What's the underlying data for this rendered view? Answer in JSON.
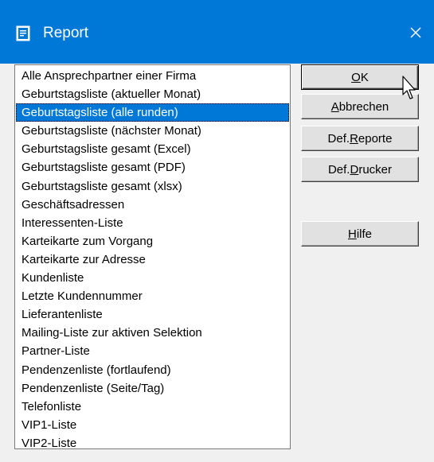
{
  "window": {
    "title": "Report",
    "app_icon": "report-document-icon",
    "close_icon": "close-icon",
    "colors": {
      "titlebar": "#0078d7",
      "selection": "#0078d7",
      "background": "#f0f0f0"
    }
  },
  "report_list": {
    "selected_index": 2,
    "items": [
      "Alle Ansprechpartner einer Firma",
      "Geburtstagsliste (aktueller Monat)",
      "Geburtstagsliste (alle runden)",
      "Geburtstagsliste (nächster Monat)",
      "Geburtstagsliste gesamt (Excel)",
      "Geburtstagsliste gesamt (PDF)",
      "Geburtstagsliste gesamt (xlsx)",
      "Geschäftsadressen",
      "Interessenten-Liste",
      "Karteikarte zum Vorgang",
      "Karteikarte zur Adresse",
      "Kundenliste",
      "Letzte Kundennummer",
      "Lieferantenliste",
      "Mailing-Liste zur aktiven Selektion",
      "Partner-Liste",
      "Pendenzenliste (fortlaufend)",
      "Pendenzenliste (Seite/Tag)",
      "Telefonliste",
      "VIP1-Liste",
      "VIP2-Liste"
    ]
  },
  "buttons": {
    "ok": {
      "pre": "",
      "acc": "O",
      "post": "K"
    },
    "cancel": {
      "pre": "",
      "acc": "A",
      "post": "bbrechen"
    },
    "def_reports": {
      "pre": "Def.",
      "acc": "R",
      "post": "eporte"
    },
    "def_printer": {
      "pre": "Def.",
      "acc": "D",
      "post": "rucker"
    },
    "help": {
      "pre": "",
      "acc": "H",
      "post": "ilfe"
    }
  }
}
